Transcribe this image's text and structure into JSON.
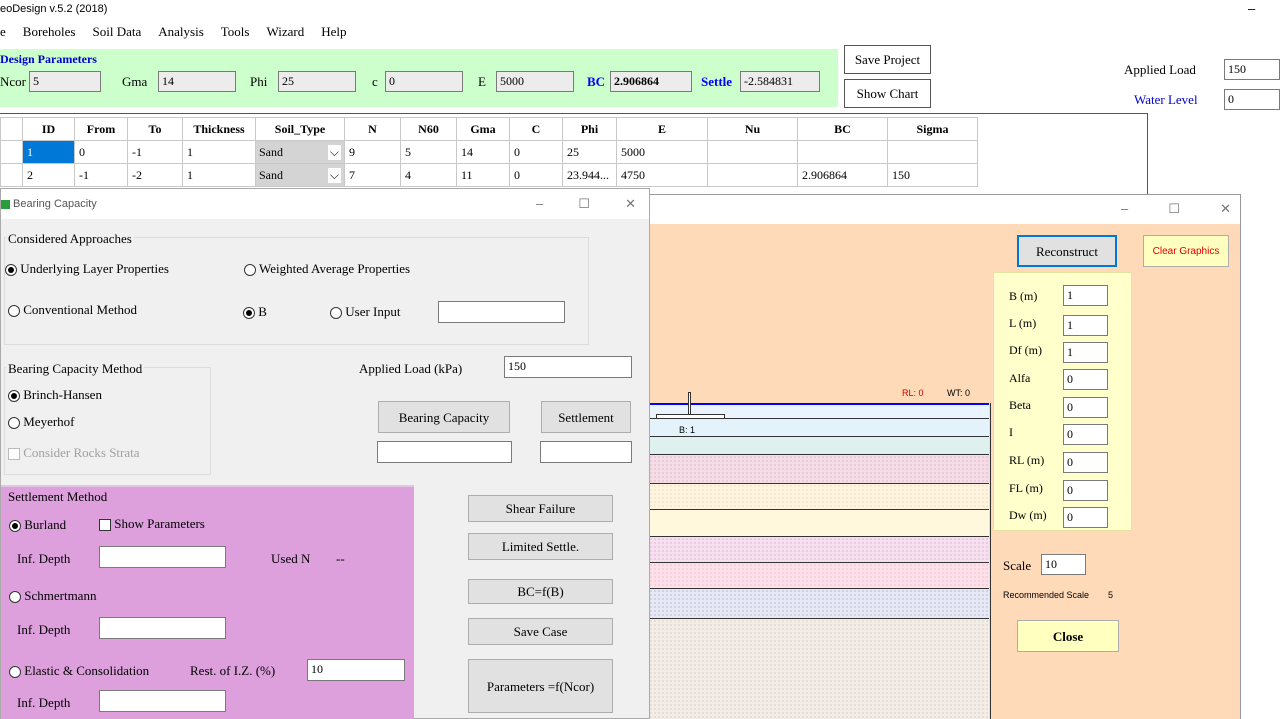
{
  "app": {
    "title": "eoDesign v.5.2 (2018)",
    "minimize": "–"
  },
  "menu": [
    "e",
    "Boreholes",
    "Soil Data",
    "Analysis",
    "Tools",
    "Wizard",
    "Help"
  ],
  "design": {
    "title": "Design Parameters",
    "ncor_label": "Ncor",
    "ncor": "5",
    "gma_label": "Gma",
    "gma": "14",
    "phi_label": "Phi",
    "phi": "25",
    "c_label": "c",
    "c": "0",
    "e_label": "E",
    "e": "5000",
    "bc_label": "BC",
    "bc": "2.906864",
    "settle_label": "Settle",
    "settle": "-2.584831"
  },
  "buttons": {
    "save_project": "Save Project",
    "show_chart": "Show Chart"
  },
  "right": {
    "applied_load_label": "Applied Load",
    "applied_load": "150",
    "water_level_label": "Water Level",
    "water_level": "0"
  },
  "grid": {
    "headers": [
      "ID",
      "From",
      "To",
      "Thickness",
      "Soil_Type",
      "N",
      "N60",
      "Gma",
      "C",
      "Phi",
      "E",
      "Nu",
      "BC",
      "Sigma"
    ],
    "rows": [
      [
        "1",
        "0",
        "-1",
        "1",
        "Sand",
        "9",
        "5",
        "14",
        "0",
        "25",
        "5000",
        "",
        "",
        ""
      ],
      [
        "2",
        "-1",
        "-2",
        "1",
        "Sand",
        "7",
        "4",
        "11",
        "0",
        "23.944...",
        "4750",
        "",
        "2.906864",
        "150"
      ]
    ]
  },
  "bc_dialog": {
    "title": "Bearing Capacity",
    "approaches_title": "Considered Approaches",
    "underlying": "Underlying Layer Properties",
    "weighted": "Weighted Average Properties",
    "conventional": "Conventional Method",
    "b": "B",
    "user_input": "User Input",
    "bcm_title": "Bearing Capacity Method",
    "brinch": "Brinch-Hansen",
    "meyerhof": "Meyerhof",
    "rocks": "Consider Rocks Strata",
    "applied_load_label": "Applied Load (kPa)",
    "applied_load": "150",
    "bearing_capacity_btn": "Bearing Capacity",
    "settlement_btn": "Settlement",
    "settle_title": "Settlement Method",
    "burland": "Burland",
    "show_params": "Show Parameters",
    "inf_depth": "Inf. Depth",
    "used_n_label": "Used N",
    "used_n": "--",
    "schmertmann": "Schmertmann",
    "elastic": "Elastic & Consolidation",
    "rest_iz_label": "Rest. of I.Z. (%)",
    "rest_iz": "10",
    "shear_failure": "Shear Failure",
    "limited_settle": "Limited Settle.",
    "bc_fb": "BC=f(B)",
    "save_case": "Save Case",
    "params_ncor": "Parameters =f(Ncor)"
  },
  "graphics": {
    "reconstruct": "Reconstruct",
    "clear_graphics": "Clear Graphics",
    "rl_label": "RL: 0",
    "wt_label": "WT: 0",
    "b_label": "B: 1",
    "params": [
      {
        "label": "B (m)",
        "value": "1"
      },
      {
        "label": "L (m)",
        "value": "1"
      },
      {
        "label": "Df (m)",
        "value": "1"
      },
      {
        "label": "Alfa",
        "value": "0"
      },
      {
        "label": "Beta",
        "value": "0"
      },
      {
        "label": "I",
        "value": "0"
      },
      {
        "label": "RL (m)",
        "value": "0"
      },
      {
        "label": "FL (m)",
        "value": "0"
      },
      {
        "label": "Dw (m)",
        "value": "0"
      }
    ],
    "scale_label": "Scale",
    "scale": "10",
    "recommended_label": "Recommended Scale",
    "recommended": "5",
    "close": "Close"
  },
  "colors": {
    "params_bg": "#ccffcc",
    "settle_bg": "#dda0dd",
    "canvas_bg": "#ffdab9",
    "param_panel_bg": "#ffffcc",
    "selected": "#0078d7",
    "accent_blue": "#0000ff"
  }
}
